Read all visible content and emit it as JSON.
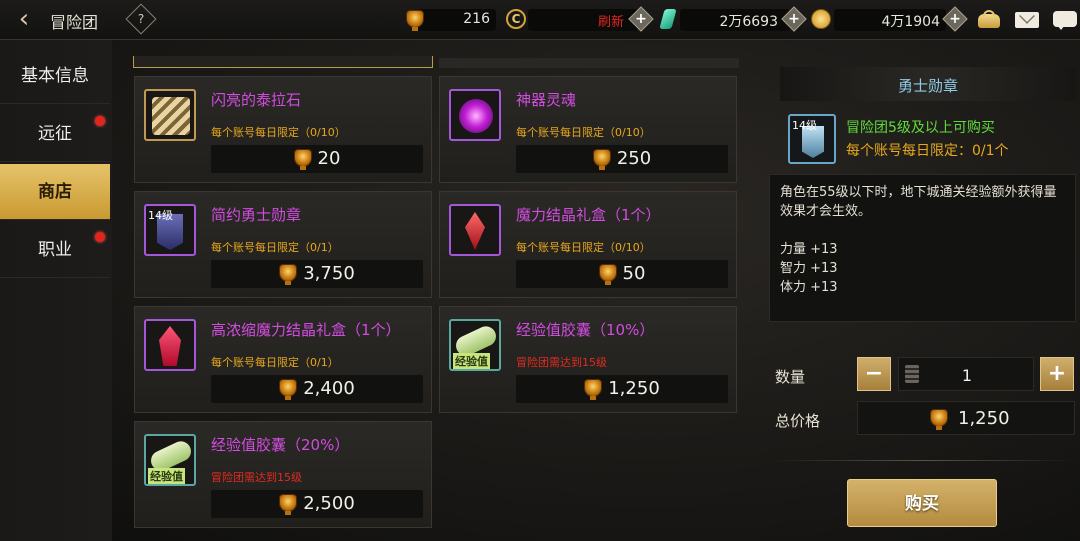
{
  "header": {
    "title": "冒险团",
    "help_label": "?",
    "currency_1": {
      "icon": "trophy-icon",
      "value": "216"
    },
    "currency_2": {
      "icon": "ccoin-icon",
      "label": "刷新"
    },
    "currency_3": {
      "icon": "crystal-icon",
      "value": "2万6693"
    },
    "currency_4": {
      "icon": "gold-coin-icon",
      "value": "4万1904"
    },
    "plus_label": "+"
  },
  "sidebar": {
    "items": [
      {
        "label": "基本信息",
        "active": false,
        "dot": false
      },
      {
        "label": "远征",
        "active": false,
        "dot": true
      },
      {
        "label": "商店",
        "active": true,
        "dot": false
      },
      {
        "label": "职业",
        "active": false,
        "dot": true
      }
    ]
  },
  "shop": {
    "items": [
      {
        "name": "闪亮的泰拉石",
        "limit": "每个账号每日限定（0/10）",
        "price": "20",
        "icon": "terra-stone-icon"
      },
      {
        "name": "神器灵魂",
        "limit": "每个账号每日限定（0/10）",
        "price": "250",
        "icon": "artifact-soul-icon"
      },
      {
        "name": "简约勇士勋章",
        "limit": "每个账号每日限定（0/1）",
        "price": "3,750",
        "icon": "medal-icon",
        "level": "14级"
      },
      {
        "name": "魔力结晶礼盒（1个）",
        "limit": "每个账号每日限定（0/10）",
        "price": "50",
        "icon": "crystal-box-icon"
      },
      {
        "name": "高浓缩魔力结晶礼盒（1个）",
        "limit": "每个账号每日限定（0/1）",
        "price": "2,400",
        "icon": "crystal-box-icon"
      },
      {
        "name": "经验值胶囊（10%）",
        "limit": "冒险团需达到15级",
        "price": "1,250",
        "icon": "exp-capsule-icon",
        "icon_label": "经验值"
      },
      {
        "name": "经验值胶囊（20%）",
        "limit": "冒险团需达到15级",
        "price": "2,500",
        "icon": "exp-capsule-icon",
        "icon_label": "经验值"
      }
    ]
  },
  "detail": {
    "title": "勇士勋章",
    "level": "14级",
    "requirement": "冒险团5级及以上可购买",
    "limit": "每个账号每日限定：0/1个",
    "description": "角色在55级以下时，地下城通关经验额外获得量效果才会生效。",
    "stats": [
      "力量 +13",
      "智力 +13",
      "体力 +13"
    ],
    "qty_label": "数量",
    "qty_value": "1",
    "minus_label": "−",
    "plus_label": "+",
    "total_label": "总价格",
    "total_value": "1,250",
    "buy_label": "购买"
  },
  "colors": {
    "accent_gold": "#d4b26a",
    "name_purple": "#d24ce0",
    "limit_orange": "#e7a81d",
    "limit_red": "#e22b1f",
    "req_green": "#5fdc3a",
    "title_blue": "#8fcbe6"
  }
}
